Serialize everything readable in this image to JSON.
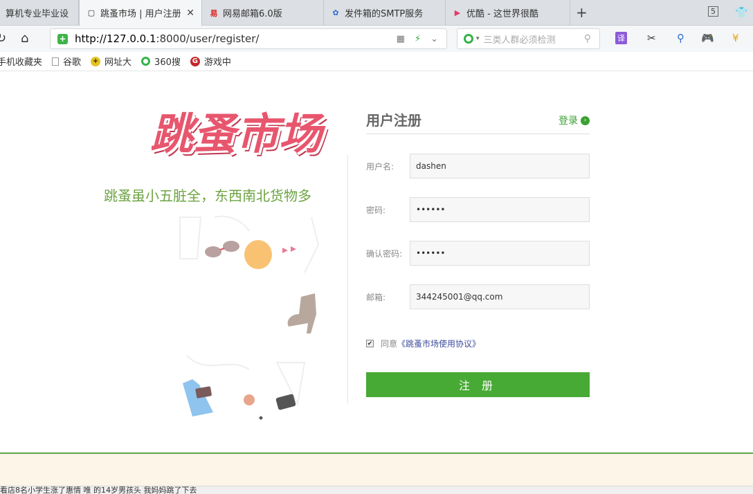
{
  "browser": {
    "tabs": [
      {
        "label": "算机专业毕业设",
        "active": false
      },
      {
        "label": "跳蚤市场 | 用户注册",
        "active": true
      },
      {
        "label": "网易邮箱6.0版",
        "active": false
      },
      {
        "label": "发件箱的SMTP服务",
        "active": false
      },
      {
        "label": "优酷 - 这世界很酷",
        "active": false
      }
    ],
    "tab_count": "5",
    "url_host": "http://127.0.0.1",
    "url_path": ":8000/user/register/",
    "search_placeholder": "三类人群必须检测",
    "translate_label": "译"
  },
  "bookmarks": [
    {
      "label": "手机收藏夹",
      "icon": "folder-icon"
    },
    {
      "label": "谷歌",
      "icon": "page-icon"
    },
    {
      "label": "网址大",
      "icon": "web-icon"
    },
    {
      "label": "360搜",
      "icon": "360-icon"
    },
    {
      "label": "游戏中",
      "icon": "game-icon"
    }
  ],
  "brand": {
    "logo_text": "跳蚤市场",
    "slogan": "跳蚤虽小五脏全，东西南北货物多"
  },
  "form": {
    "title": "用户注册",
    "login_label": "登录",
    "username_label": "用户名:",
    "username_value": "dashen",
    "password_label": "密码:",
    "password_value": "••••••",
    "confirm_label": "确认密码:",
    "confirm_value": "••••••",
    "email_label": "邮箱:",
    "email_value": "344245001@qq.com",
    "agree_text": "同意",
    "agree_link": "《跳蚤市场使用协议》",
    "submit_label": "注 册"
  },
  "status_text": "看店8名小学生涨了惠情   唯 的14岁男孩头  我妈妈跳了下去",
  "colors": {
    "accent_green": "#47aa34",
    "logo_pink": "#e8566e",
    "slogan_green": "#6ca342"
  }
}
